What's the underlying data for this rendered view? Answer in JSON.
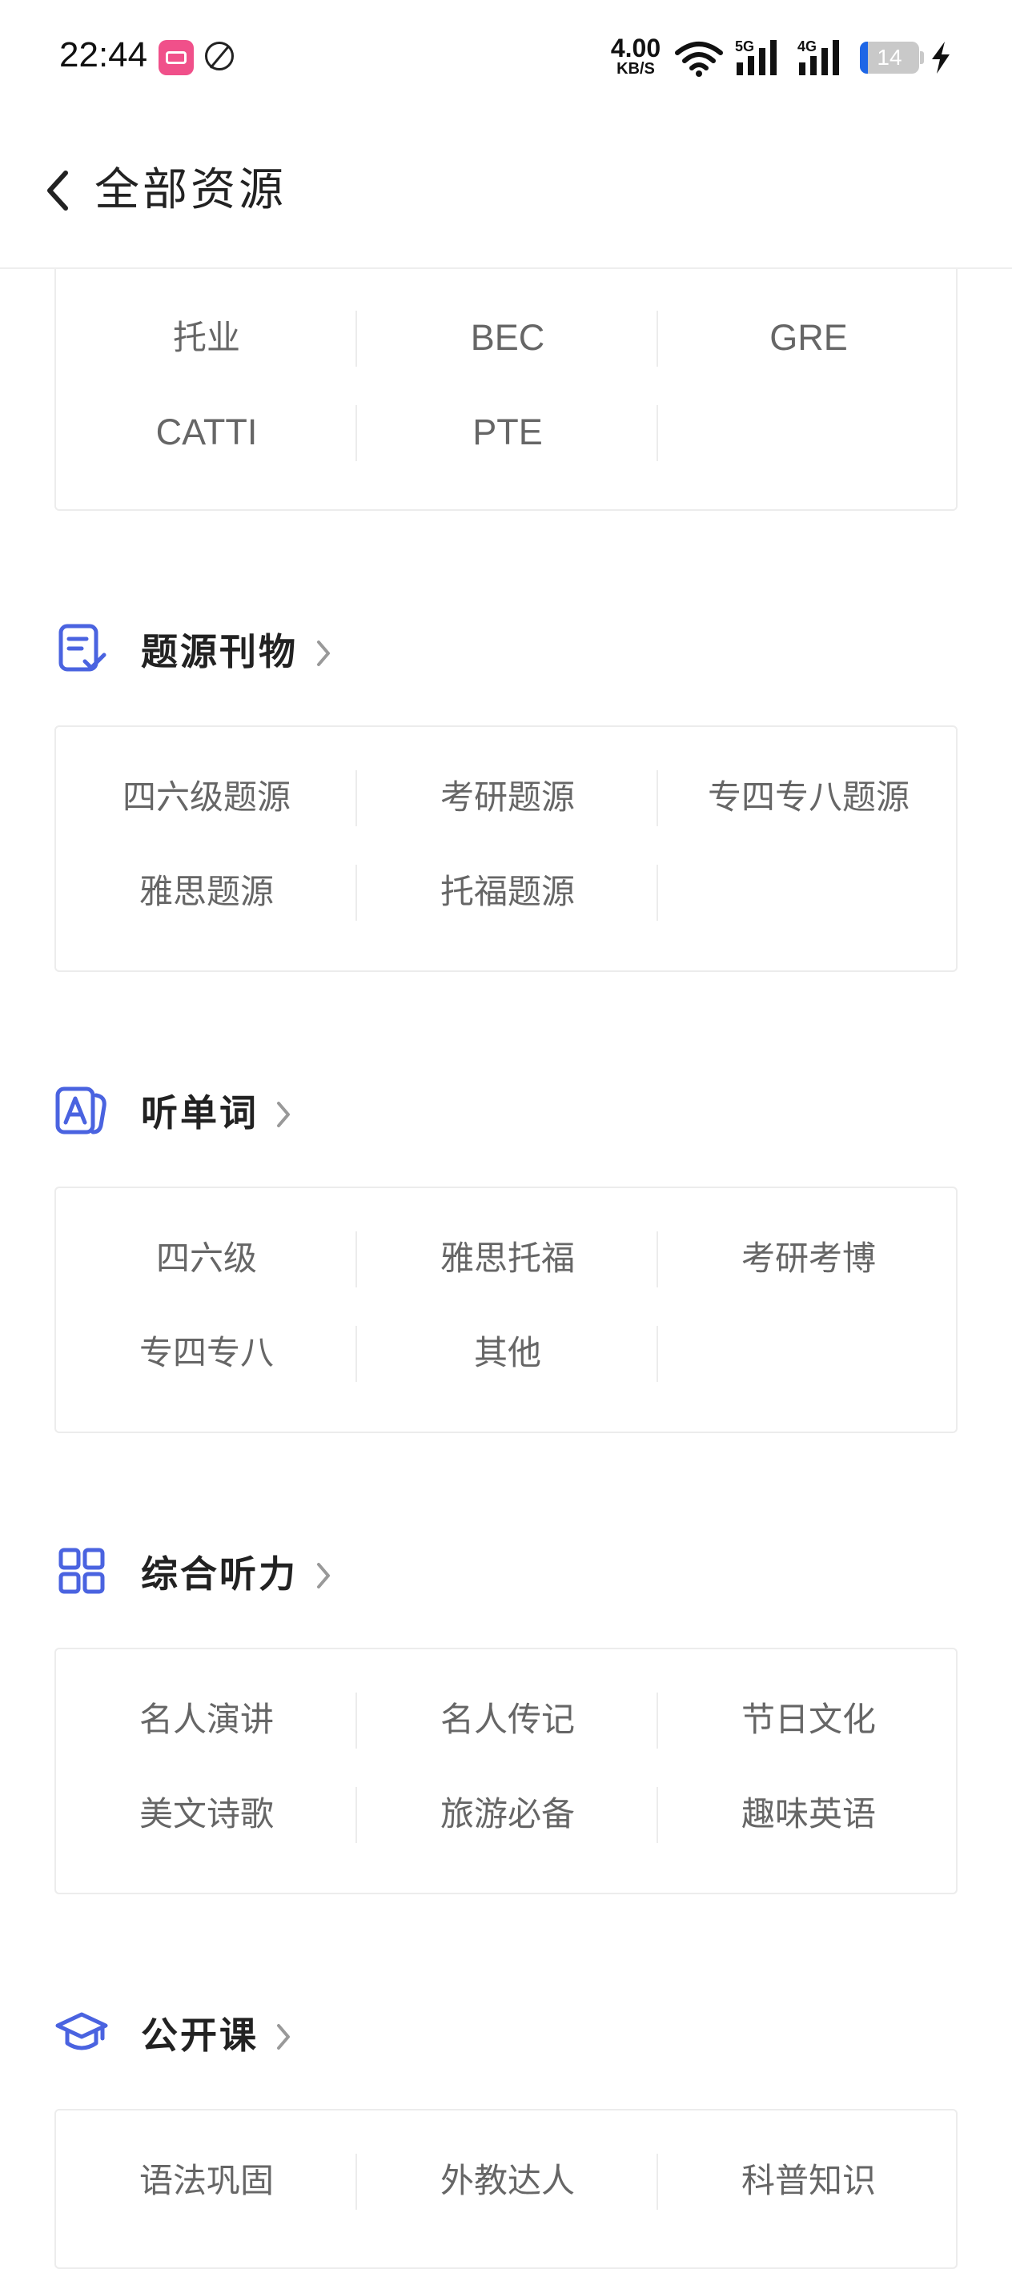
{
  "status_bar": {
    "time": "22:44",
    "speed_value": "4.00",
    "speed_unit": "KB/S",
    "sim1_label": "5G",
    "sim2_label": "4G",
    "battery_level": "14",
    "icons": [
      "bilibili-app-icon",
      "no-disturb-icon",
      "wifi-icon",
      "signal-icon",
      "battery-icon",
      "charging-icon"
    ]
  },
  "header": {
    "title": "全部资源",
    "back_icon": "chevron-left-icon"
  },
  "accent_color": "#4a63e0",
  "sections": {
    "exams": {
      "items": [
        "托业",
        "BEC",
        "GRE",
        "CATTI",
        "PTE"
      ]
    },
    "tiyuan": {
      "title": "题源刊物",
      "icon": "document-check-icon",
      "items": [
        "四六级题源",
        "考研题源",
        "专四专八题源",
        "雅思题源",
        "托福题源"
      ]
    },
    "words": {
      "title": "听单词",
      "icon": "letter-a-card-icon",
      "items": [
        "四六级",
        "雅思托福",
        "考研考博",
        "专四专八",
        "其他"
      ]
    },
    "listening": {
      "title": "综合听力",
      "icon": "grid-icon",
      "items": [
        "名人演讲",
        "名人传记",
        "节日文化",
        "美文诗歌",
        "旅游必备",
        "趣味英语"
      ]
    },
    "courses": {
      "title": "公开课",
      "icon": "graduation-cap-icon",
      "items": [
        "语法巩固",
        "外教达人",
        "科普知识"
      ]
    }
  }
}
